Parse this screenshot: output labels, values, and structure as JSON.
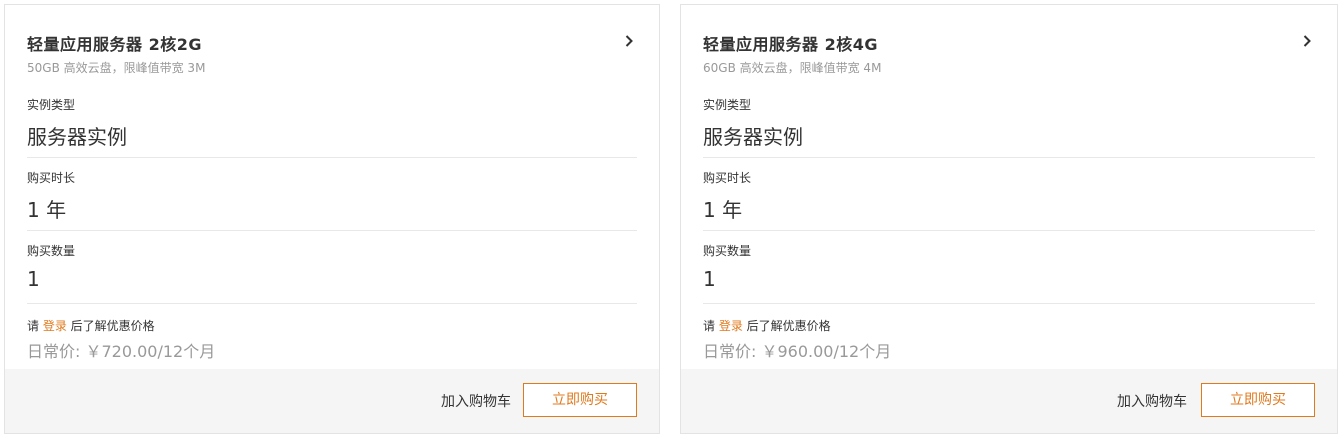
{
  "products": [
    {
      "title": "轻量应用服务器 2核2G",
      "subtitle": "50GB 高效云盘，限峰值带宽 3M",
      "instance_label": "实例类型",
      "instance_value": "服务器实例",
      "duration_label": "购买时长",
      "duration_value": "1 年",
      "quantity_label": "购买数量",
      "quantity_value": "1",
      "login_prefix": "请 ",
      "login_link": "登录",
      "login_suffix": " 后了解优惠价格",
      "price_text": "日常价: ￥720.00/12个月",
      "add_to_cart": "加入购物车",
      "buy_now": "立即购买",
      "chevron_icon": "chevron-right-icon"
    },
    {
      "title": "轻量应用服务器 2核4G",
      "subtitle": "60GB 高效云盘，限峰值带宽 4M",
      "instance_label": "实例类型",
      "instance_value": "服务器实例",
      "duration_label": "购买时长",
      "duration_value": "1 年",
      "quantity_label": "购买数量",
      "quantity_value": "1",
      "login_prefix": "请 ",
      "login_link": "登录",
      "login_suffix": " 后了解优惠价格",
      "price_text": "日常价: ￥960.00/12个月",
      "add_to_cart": "加入购物车",
      "buy_now": "立即购买",
      "chevron_icon": "chevron-right-icon"
    }
  ],
  "colors": {
    "accent": "#e07a1f",
    "muted_text": "#999999",
    "footer_bg": "#f5f5f5",
    "divider": "#e8e8e8"
  }
}
